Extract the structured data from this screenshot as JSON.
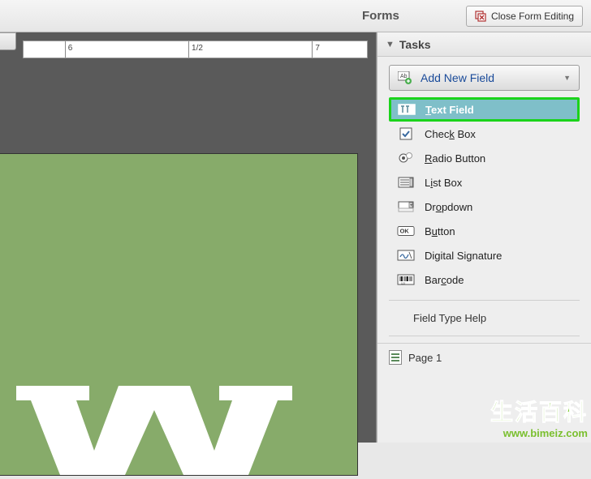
{
  "header": {
    "forms_label": "Forms",
    "close_button_label": "Close Form Editing"
  },
  "ruler": {
    "marks": [
      "6",
      "1/2",
      "7"
    ]
  },
  "tasks": {
    "title": "Tasks",
    "add_new_field_label": "Add New Field",
    "fields": [
      {
        "id": "text-field",
        "icon": "text-field-icon",
        "label_pre": "",
        "label_ul": "T",
        "label_post": "ext Field",
        "selected": true
      },
      {
        "id": "check-box",
        "icon": "check-box-icon",
        "label_pre": "Chec",
        "label_ul": "k",
        "label_post": " Box",
        "selected": false
      },
      {
        "id": "radio-button",
        "icon": "radio-button-icon",
        "label_pre": "",
        "label_ul": "R",
        "label_post": "adio Button",
        "selected": false
      },
      {
        "id": "list-box",
        "icon": "list-box-icon",
        "label_pre": "L",
        "label_ul": "i",
        "label_post": "st Box",
        "selected": false
      },
      {
        "id": "dropdown",
        "icon": "dropdown-icon",
        "label_pre": "Dr",
        "label_ul": "o",
        "label_post": "pdown",
        "selected": false
      },
      {
        "id": "button",
        "icon": "button-icon",
        "label_pre": "B",
        "label_ul": "u",
        "label_post": "tton",
        "selected": false
      },
      {
        "id": "digital-signature",
        "icon": "signature-icon",
        "label_pre": "Di",
        "label_ul": "g",
        "label_post": "ital Signature",
        "selected": false
      },
      {
        "id": "barcode",
        "icon": "barcode-icon",
        "label_pre": "Bar",
        "label_ul": "c",
        "label_post": "ode",
        "selected": false
      }
    ],
    "help_label": "Field Type Help"
  },
  "pages": {
    "items": [
      {
        "label": "Page 1"
      }
    ]
  },
  "watermark": {
    "cn_text": "生活百科",
    "url_text": "www.bimeiz.com"
  }
}
